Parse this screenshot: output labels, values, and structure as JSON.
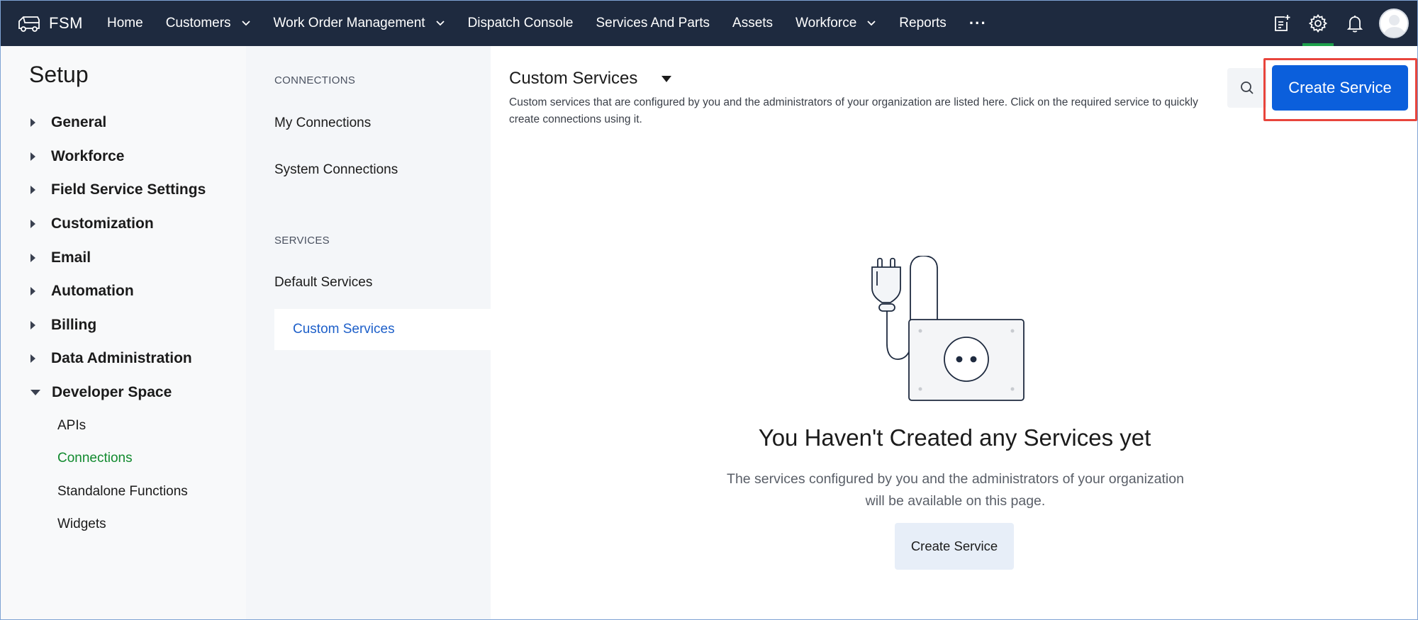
{
  "app": {
    "name": "FSM"
  },
  "nav": {
    "items": [
      {
        "label": "Home",
        "dropdown": false
      },
      {
        "label": "Customers",
        "dropdown": true
      },
      {
        "label": "Work Order Management",
        "dropdown": true
      },
      {
        "label": "Dispatch Console",
        "dropdown": false
      },
      {
        "label": "Services And Parts",
        "dropdown": false
      },
      {
        "label": "Assets",
        "dropdown": false
      },
      {
        "label": "Workforce",
        "dropdown": true
      },
      {
        "label": "Reports",
        "dropdown": false
      }
    ],
    "more": "···",
    "icons": [
      "add-note-icon",
      "gear-icon",
      "bell-icon",
      "avatar"
    ],
    "active_icon": "gear-icon"
  },
  "setup": {
    "title": "Setup",
    "items": [
      {
        "label": "General",
        "expanded": false
      },
      {
        "label": "Workforce",
        "expanded": false
      },
      {
        "label": "Field Service Settings",
        "expanded": false
      },
      {
        "label": "Customization",
        "expanded": false
      },
      {
        "label": "Email",
        "expanded": false
      },
      {
        "label": "Automation",
        "expanded": false
      },
      {
        "label": "Billing",
        "expanded": false
      },
      {
        "label": "Data Administration",
        "expanded": false
      },
      {
        "label": "Developer Space",
        "expanded": true
      }
    ],
    "sub_items": [
      {
        "label": "APIs",
        "active": false
      },
      {
        "label": "Connections",
        "active": true
      },
      {
        "label": "Standalone Functions",
        "active": false
      },
      {
        "label": "Widgets",
        "active": false
      }
    ]
  },
  "connections_panel": {
    "connections_header": "CONNECTIONS",
    "connections_items": [
      "My Connections",
      "System Connections"
    ],
    "services_header": "SERVICES",
    "services_items": [
      "Default Services",
      "Custom Services"
    ],
    "selected": "Custom Services"
  },
  "main": {
    "title": "Custom Services",
    "description": "Custom services that are configured by you and the administrators of your organization are listed here. Click on the required service to quickly create connections using it.",
    "create_button": "Create Service",
    "empty_title": "You Haven't Created any Services yet",
    "empty_description": "The services configured by you and the administrators of your organization will be available on this page.",
    "empty_button": "Create Service"
  },
  "colors": {
    "topbar": "#1e2a3f",
    "primary_button": "#0b5fdc",
    "highlight_border": "#e8453c",
    "active_green": "#118a2e",
    "selected_blue": "#1d5fc9"
  }
}
